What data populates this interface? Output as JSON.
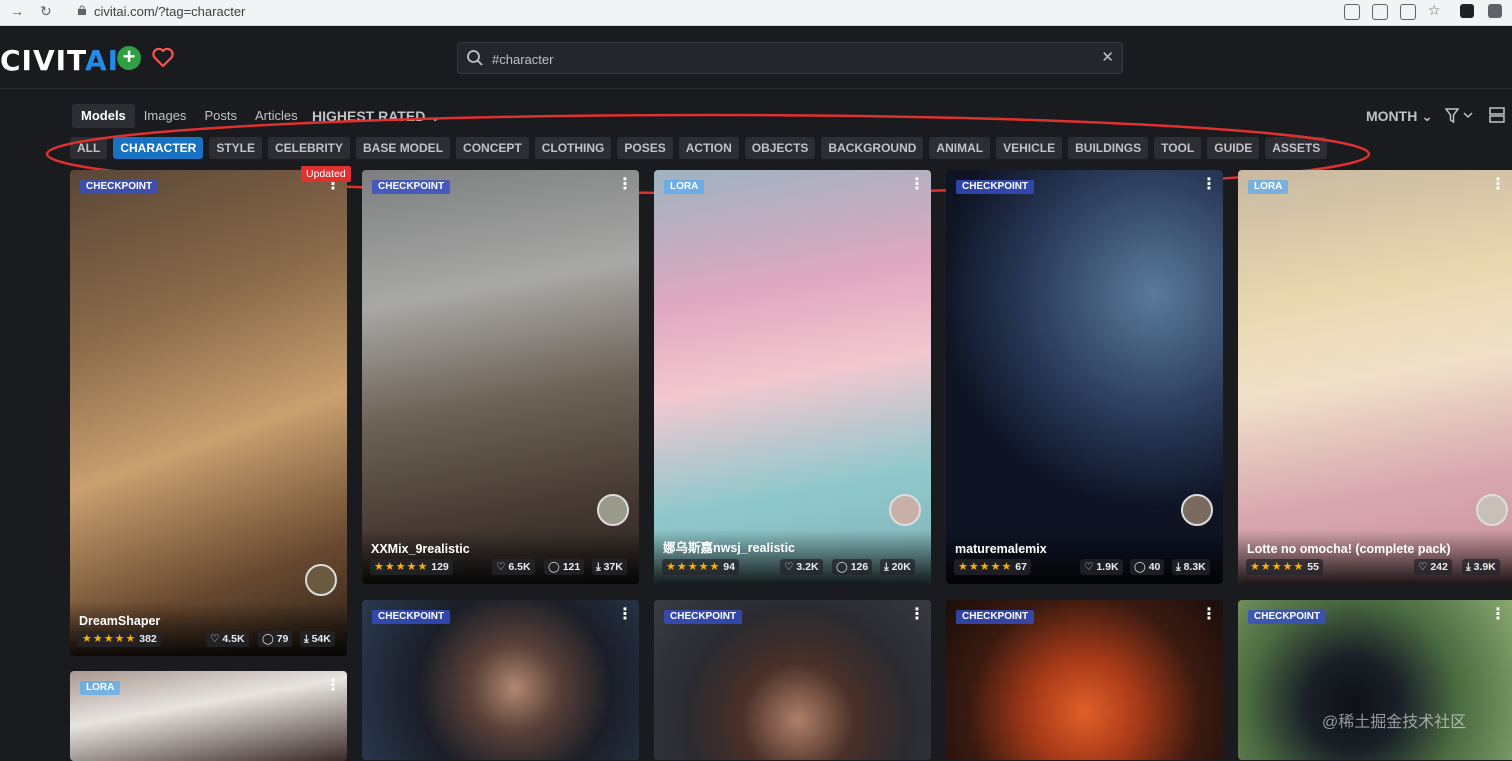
{
  "browser": {
    "url": "civitai.com/?tag=character"
  },
  "header": {
    "logo_left": "CIVIT",
    "logo_right": "AI",
    "search_value": "#character"
  },
  "tabs": [
    "Models",
    "Images",
    "Posts",
    "Articles"
  ],
  "sort_label": "HIGHEST RATED",
  "period_label": "MONTH",
  "categories": [
    "ALL",
    "CHARACTER",
    "STYLE",
    "CELEBRITY",
    "BASE MODEL",
    "CONCEPT",
    "CLOTHING",
    "POSES",
    "ACTION",
    "OBJECTS",
    "BACKGROUND",
    "ANIMAL",
    "VEHICLE",
    "BUILDINGS",
    "TOOL",
    "GUIDE",
    "ASSETS"
  ],
  "active_category": "CHARACTER",
  "updated_badge": "Updated",
  "cards": [
    {
      "type": "CHECKPOINT",
      "title": "DreamShaper",
      "rating": "382",
      "likes": "4.5K",
      "comments": "79",
      "downloads": "54K"
    },
    {
      "type": "CHECKPOINT",
      "title": "XXMix_9realistic",
      "rating": "129",
      "likes": "6.5K",
      "comments": "121",
      "downloads": "37K"
    },
    {
      "type": "LORA",
      "title": "娜乌斯嘉nwsj_realistic",
      "rating": "94",
      "likes": "3.2K",
      "comments": "126",
      "downloads": "20K"
    },
    {
      "type": "CHECKPOINT",
      "title": "maturemalemix",
      "rating": "67",
      "likes": "1.9K",
      "comments": "40",
      "downloads": "8.3K"
    },
    {
      "type": "LORA",
      "title": "Lotte no omocha! (complete pack)",
      "rating": "55",
      "likes": "242",
      "downloads": "3.9K"
    },
    {
      "type": "LORA"
    },
    {
      "type": "CHECKPOINT"
    },
    {
      "type": "CHECKPOINT"
    },
    {
      "type": "CHECKPOINT"
    },
    {
      "type": "CHECKPOINT"
    }
  ],
  "watermark": "@稀土掘金技术社区",
  "colors": {
    "accent": "#1971c2",
    "like_heart": "#fa5252",
    "star": "#fab005",
    "add": "#2f9e44"
  }
}
